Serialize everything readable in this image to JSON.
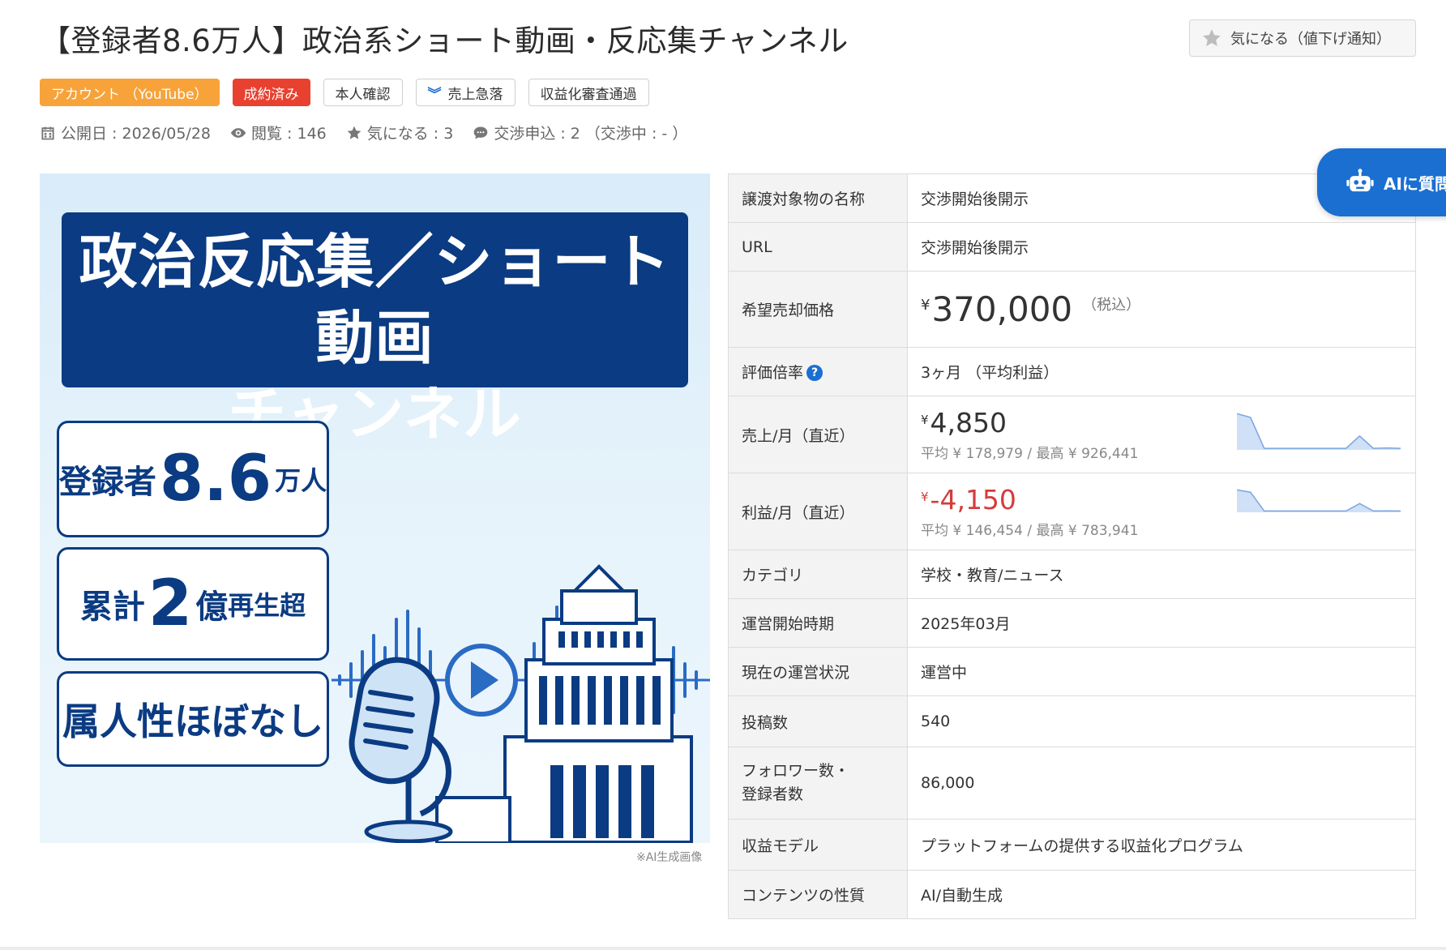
{
  "title": "【登録者8.6万人】政治系ショート動画・反応集チャンネル",
  "fav_button": {
    "icon": "star-icon",
    "label": "気になる（値下げ通知）"
  },
  "tags": [
    {
      "label": "アカウント （YouTube）",
      "style": "orange"
    },
    {
      "label": "成約済み",
      "style": "red"
    },
    {
      "label": "本人確認",
      "style": "outline"
    },
    {
      "label": "売上急落",
      "style": "outline",
      "icon": "double-chevron-down-icon"
    },
    {
      "label": "収益化審査通過",
      "style": "outline"
    }
  ],
  "meta": {
    "published": "公開日 : 2026/05/28",
    "views": "閲覧 : 146",
    "favorites": "気になる : 3",
    "negotiations": "交渉申込 : 2 （交渉中 : - ）"
  },
  "hero": {
    "banner_line1": "政治反応集／ショート動画",
    "banner_line2": "チャンネル",
    "box1_pre": "登録者",
    "box1_num": "8.6",
    "box1_post": "万人",
    "box2_pre": "累計",
    "box2_num": "2",
    "box2_mid": "億",
    "box2_post": "再生超",
    "box3": "属人性ほぼなし",
    "caption": "※AI生成画像"
  },
  "ai_button": {
    "label": "AIに質問",
    "icon": "robot-icon"
  },
  "spec": {
    "name_label": "譲渡対象物の名称",
    "name_value": "交渉開始後開示",
    "url_label": "URL",
    "url_value": "交渉開始後開示",
    "price_label": "希望売却価格",
    "price_currency": "¥",
    "price_value": "370,000",
    "price_tax": "（税込）",
    "multiple_label": "評価倍率",
    "multiple_help": "?",
    "multiple_value": "3ヶ月 （平均利益）",
    "sales_label": "売上/月（直近）",
    "sales_currency": "¥",
    "sales_value": "4,850",
    "sales_sub": "平均 ¥ 178,979 / 最高 ¥ 926,441",
    "profit_label": "利益/月（直近）",
    "profit_currency": "¥",
    "profit_value": "-4,150",
    "profit_sub": "平均 ¥ 146,454 / 最高 ¥ 783,941",
    "category_label": "カテゴリ",
    "category_value": "学校・教育/ニュース",
    "start_label": "運営開始時期",
    "start_value": "2025年03月",
    "status_label": "現在の運営状況",
    "status_value": "運営中",
    "posts_label": "投稿数",
    "posts_value": "540",
    "followers_label_1": "フォロワー数・",
    "followers_label_2": "登録者数",
    "followers_value": "86,000",
    "revenue_model_label": "収益モデル",
    "revenue_model_value": "プラットフォームの提供する収益化プログラム",
    "content_label": "コンテンツの性質",
    "content_value": "AI/自動生成"
  },
  "colors": {
    "accent": "#1a6fd1",
    "navy": "#0b3b82",
    "orange": "#f7a33a",
    "red": "#e8412f",
    "negative": "#d53b3b"
  },
  "sparklines": {
    "sales": [
      0.95,
      0.85,
      0.02,
      0.02,
      0.02,
      0.02,
      0.02,
      0.02,
      0.02,
      0.35,
      0.02,
      0.03,
      0.02
    ],
    "profit": [
      0.95,
      0.85,
      0.02,
      0.02,
      0.02,
      0.02,
      0.02,
      0.02,
      0.02,
      0.35,
      0.02,
      0.03,
      0.02
    ]
  }
}
